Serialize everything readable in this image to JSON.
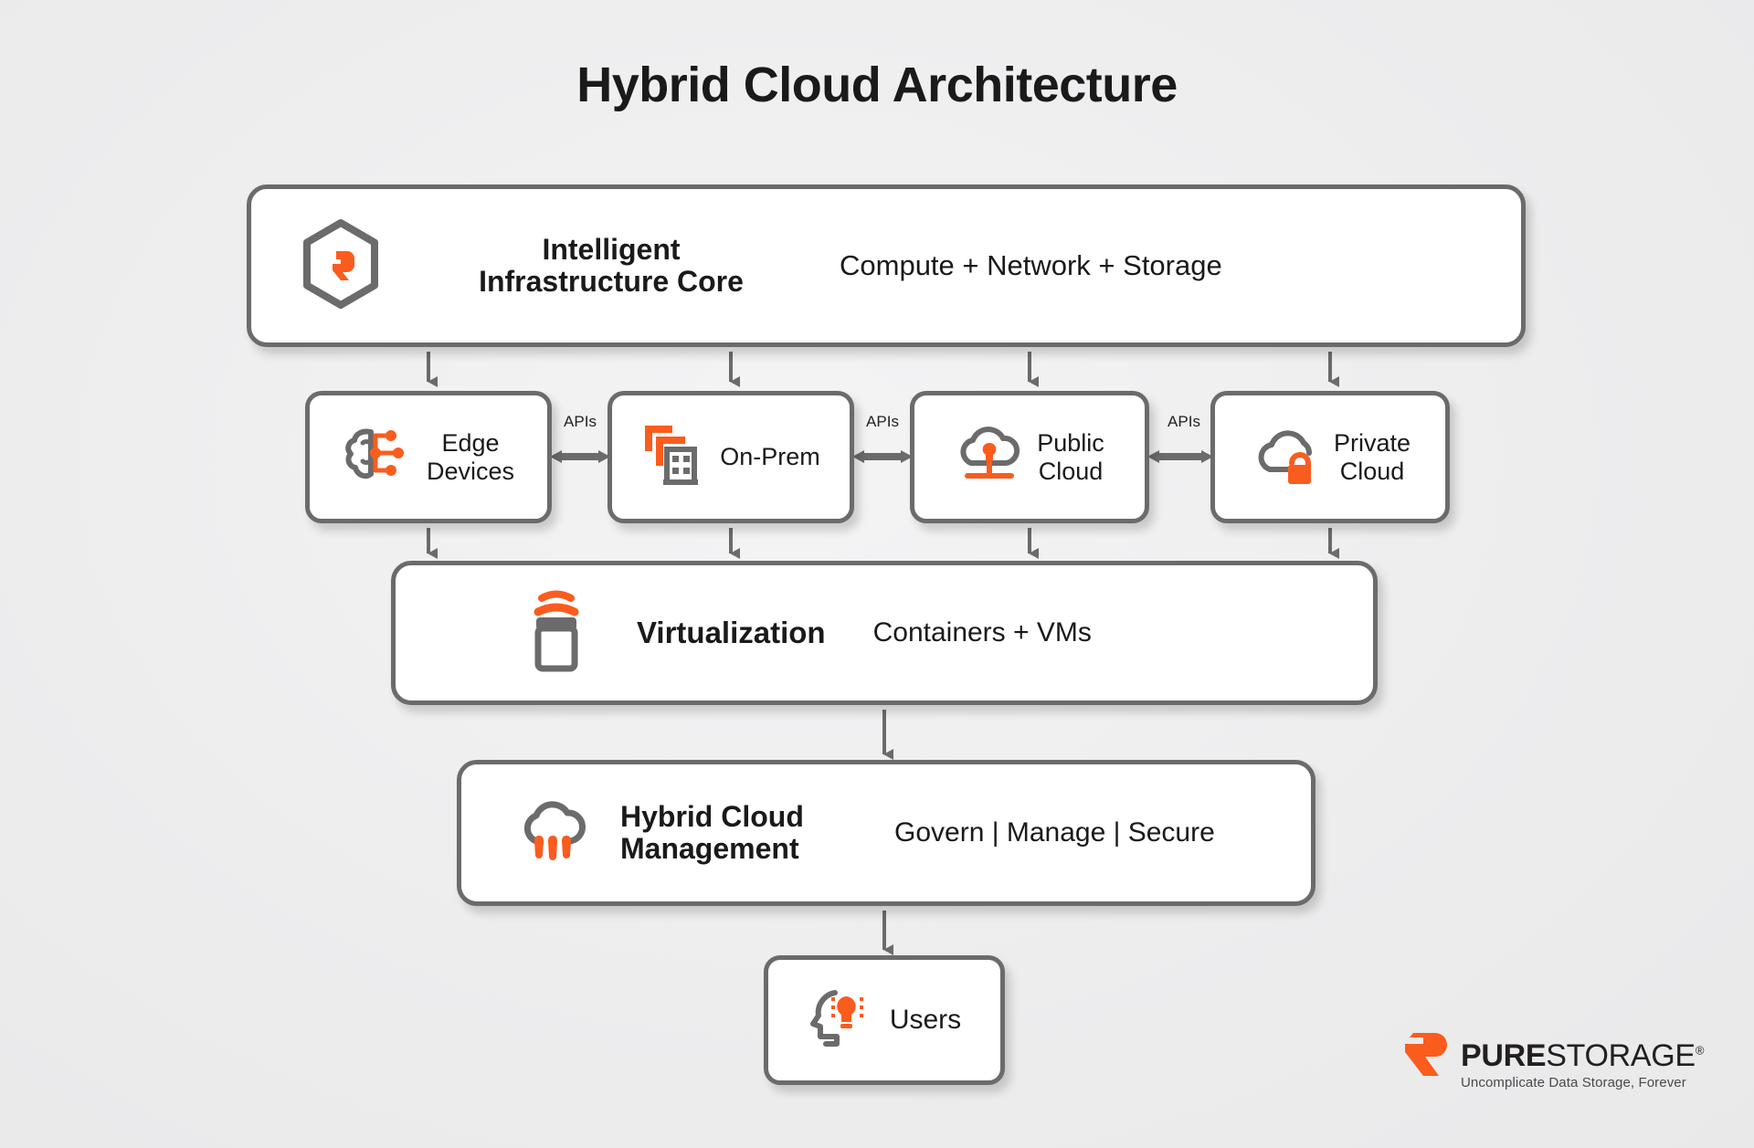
{
  "page": {
    "title": "Hybrid Cloud Architecture",
    "background_color": "#efefef",
    "accent_color": "#fa5c1e",
    "outline_color": "#6b6b6b",
    "text_color": "#1a1a1a"
  },
  "core": {
    "icon": "hexagon-pure-logo-icon",
    "title": "Intelligent\nInfrastructure Core",
    "title_line1": "Intelligent",
    "title_line2": "Infrastructure Core",
    "subtitle": "Compute + Network + Storage"
  },
  "tier2": {
    "items": [
      {
        "id": "edge",
        "icon": "brain-circuit-icon",
        "label_line1": "Edge",
        "label_line2": "Devices"
      },
      {
        "id": "onprem",
        "icon": "datacenter-building-icon",
        "label_line1": "On-Prem",
        "label_line2": ""
      },
      {
        "id": "public",
        "icon": "cloud-network-icon",
        "label_line1": "Public",
        "label_line2": "Cloud"
      },
      {
        "id": "private",
        "icon": "cloud-lock-icon",
        "label_line1": "Private",
        "label_line2": "Cloud"
      }
    ],
    "connector_labels": [
      "APIs",
      "APIs",
      "APIs"
    ]
  },
  "virtualization": {
    "icon": "container-stack-icon",
    "title": "Virtualization",
    "subtitle": "Containers + VMs"
  },
  "management": {
    "icon": "cloud-rain-icon",
    "title_line1": "Hybrid Cloud",
    "title_line2": "Management",
    "subtitle": "Govern | Manage | Secure"
  },
  "users": {
    "icon": "head-idea-icon",
    "label": "Users"
  },
  "logo": {
    "mark": "pure-storage-mark-icon",
    "word_bold": "PURE",
    "word_light": "STORAGE",
    "registered": "®",
    "tagline": "Uncomplicate Data Storage, Forever"
  }
}
